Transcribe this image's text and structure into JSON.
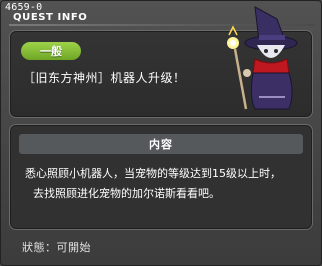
{
  "window": {
    "quest_id": "4659-0",
    "title": "QUEST INFO"
  },
  "quest": {
    "category": "一般",
    "name": "［旧东方神州］机器人升级！",
    "portrait": "wizard-npc-portrait"
  },
  "content": {
    "header": "内容",
    "lines": [
      "悉心照顾小机器人，当宠物的等级达到15级以上时，",
      "去找照顾进化宠物的加尔诺斯看看吧。"
    ]
  },
  "status": {
    "text": "狀態：可開始"
  },
  "colors": {
    "tag_green": "#8cc63f",
    "window_bg": "#4a4a4a",
    "panel_bg": "#313131"
  }
}
